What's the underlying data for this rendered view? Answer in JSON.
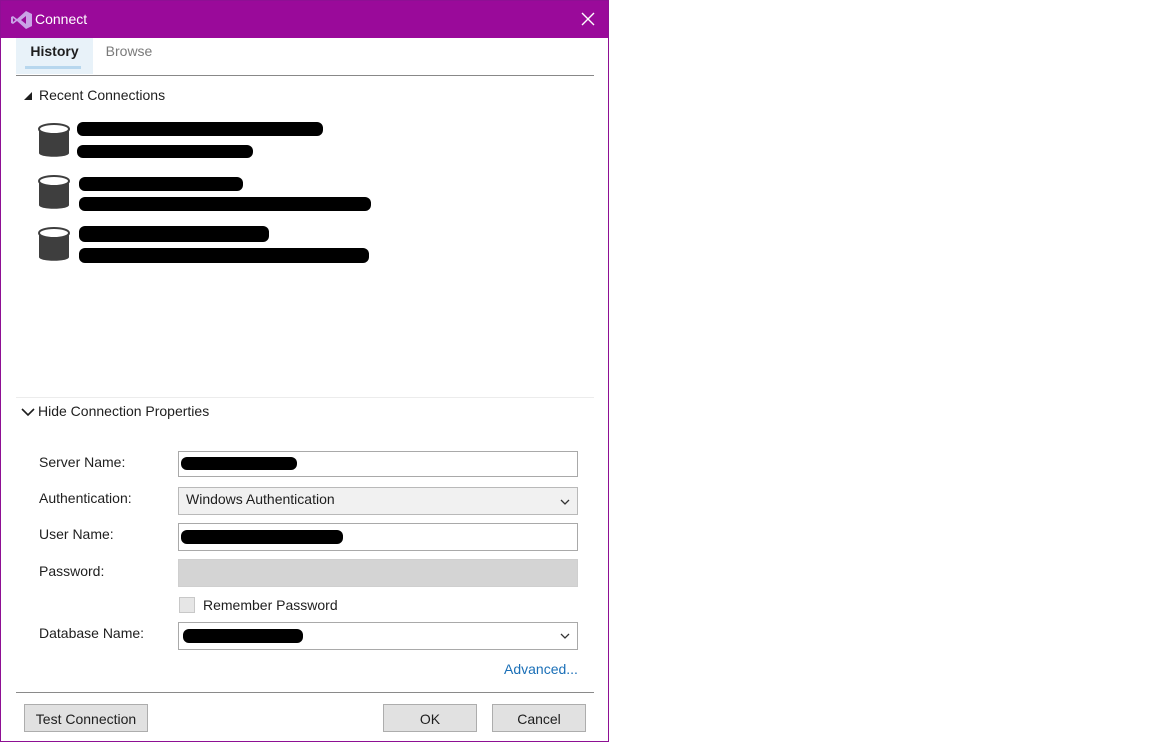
{
  "window": {
    "title": "Connect",
    "accent_color": "#9a0a9a",
    "close_icon": "close-icon"
  },
  "tabs": [
    {
      "label": "History",
      "selected": true
    },
    {
      "label": "Browse",
      "selected": false
    }
  ],
  "recent": {
    "header": "Recent Connections",
    "expanded": true,
    "items": [
      {
        "icon": "database-icon",
        "redacted": true
      },
      {
        "icon": "database-icon",
        "redacted": true
      },
      {
        "icon": "database-icon",
        "redacted": true
      }
    ]
  },
  "properties": {
    "header": "Hide Connection Properties",
    "server_name_label": "Server Name:",
    "authentication_label": "Authentication:",
    "authentication_value": "Windows Authentication",
    "user_name_label": "User Name:",
    "password_label": "Password:",
    "remember_password_label": "Remember Password",
    "remember_password_checked": false,
    "database_name_label": "Database Name:",
    "advanced_link": "Advanced..."
  },
  "buttons": {
    "test_connection": "Test Connection",
    "ok": "OK",
    "cancel": "Cancel"
  }
}
